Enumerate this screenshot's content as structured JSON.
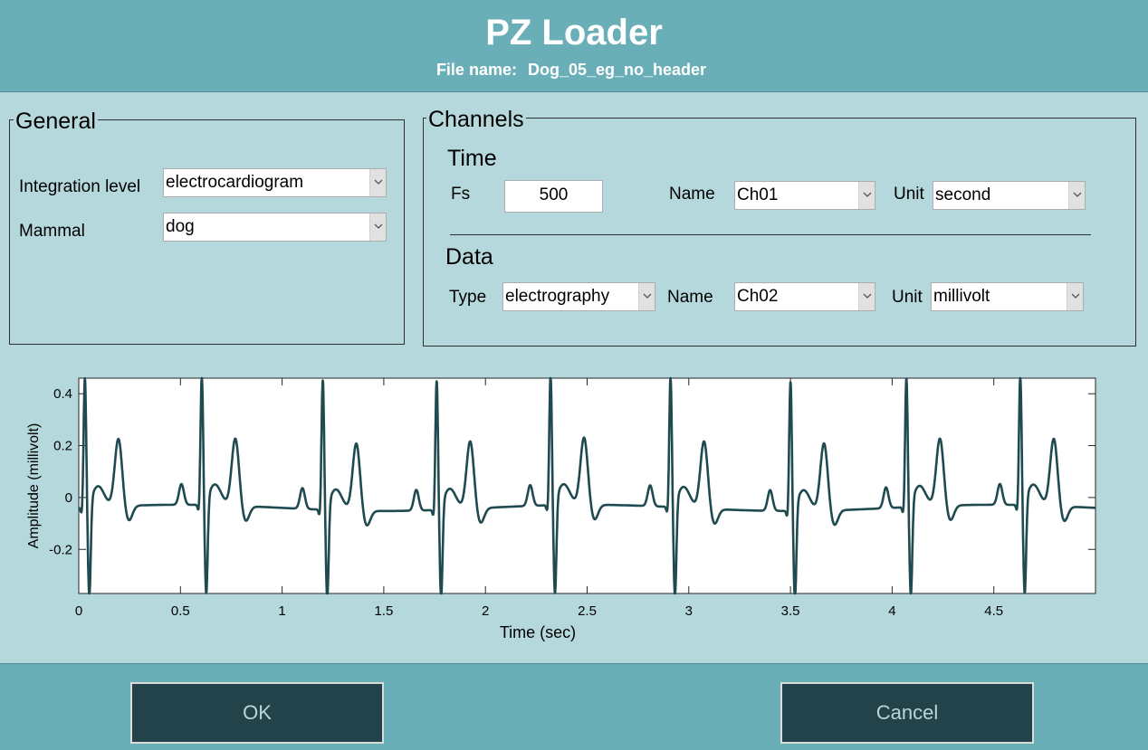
{
  "header": {
    "title": "PZ Loader",
    "file_label": "File name:",
    "file_name": "Dog_05_eg_no_header"
  },
  "general": {
    "title": "General",
    "integration_label": "Integration level",
    "integration_value": "electrocardiogram",
    "mammal_label": "Mammal",
    "mammal_value": "dog"
  },
  "channels": {
    "title": "Channels",
    "time": {
      "title": "Time",
      "fs_label": "Fs",
      "fs_value": "500",
      "name_label": "Name",
      "name_value": "Ch01",
      "unit_label": "Unit",
      "unit_value": "second"
    },
    "data": {
      "title": "Data",
      "type_label": "Type",
      "type_value": "electrography",
      "name_label": "Name",
      "name_value": "Ch02",
      "unit_label": "Unit",
      "unit_value": "millivolt"
    }
  },
  "chart_data": {
    "type": "line",
    "xlabel": "Time (sec)",
    "ylabel": "Amplitude (millivolt)",
    "xlim": [
      0,
      5
    ],
    "ylim": [
      -0.37,
      0.46
    ],
    "x_ticks": [
      0,
      0.5,
      1,
      1.5,
      2,
      2.5,
      3,
      3.5,
      4,
      4.5
    ],
    "x_tick_labels": [
      "0",
      "0.5",
      "1",
      "1.5",
      "2",
      "2.5",
      "3",
      "3.5",
      "4",
      "4.5"
    ],
    "y_ticks": [
      0.4,
      0.2,
      0,
      -0.2
    ],
    "y_tick_labels": [
      "0.4",
      "0.2",
      "0",
      "-0.2"
    ],
    "line_color": "#1f4a4f",
    "grid": false,
    "series": [
      {
        "r_peak_times": [
          0.03,
          0.605,
          1.2,
          1.76,
          2.32,
          2.91,
          3.5,
          4.07,
          4.63
        ],
        "r_peak_amplitude": 0.43,
        "s_trough_amplitude": -0.35,
        "t_wave_amplitude": 0.21,
        "p_wave_amplitude": 0.04,
        "baseline": -0.04
      }
    ]
  },
  "buttons": {
    "ok": "OK",
    "cancel": "Cancel"
  }
}
